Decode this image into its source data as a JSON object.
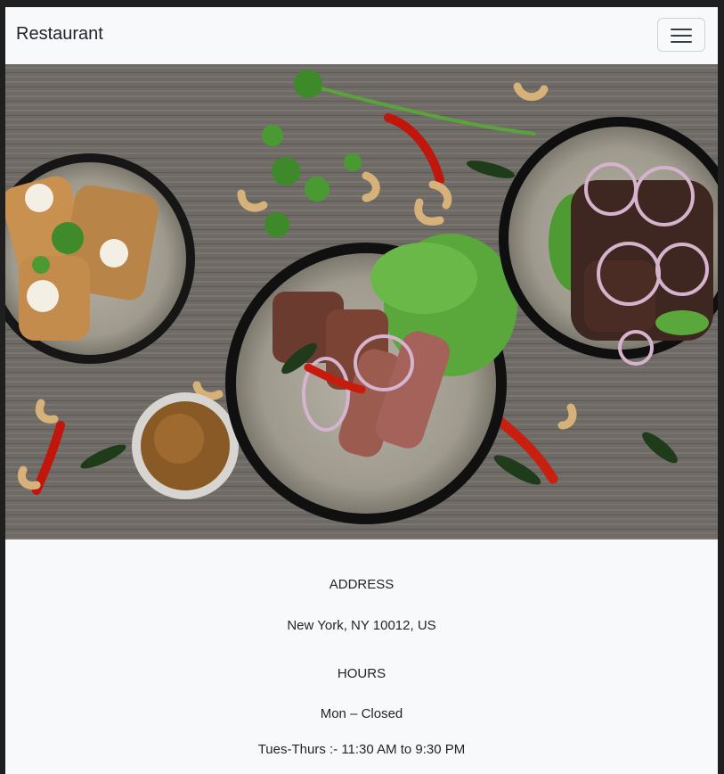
{
  "navbar": {
    "brand": "Restaurant",
    "menu_icon": "hamburger-menu-icon"
  },
  "hero": {
    "image": "food-plates-photo"
  },
  "info": {
    "address_heading": "ADDRESS",
    "address": "New York, NY 10012, US",
    "hours_heading": "HOURS",
    "hours_mon": "Mon – Closed",
    "hours_tue_thu": "Tues-Thurs :- 11:30 AM to 9:30 PM"
  },
  "colors": {
    "navbar_bg": "#f8f9fa",
    "text": "#212529"
  }
}
